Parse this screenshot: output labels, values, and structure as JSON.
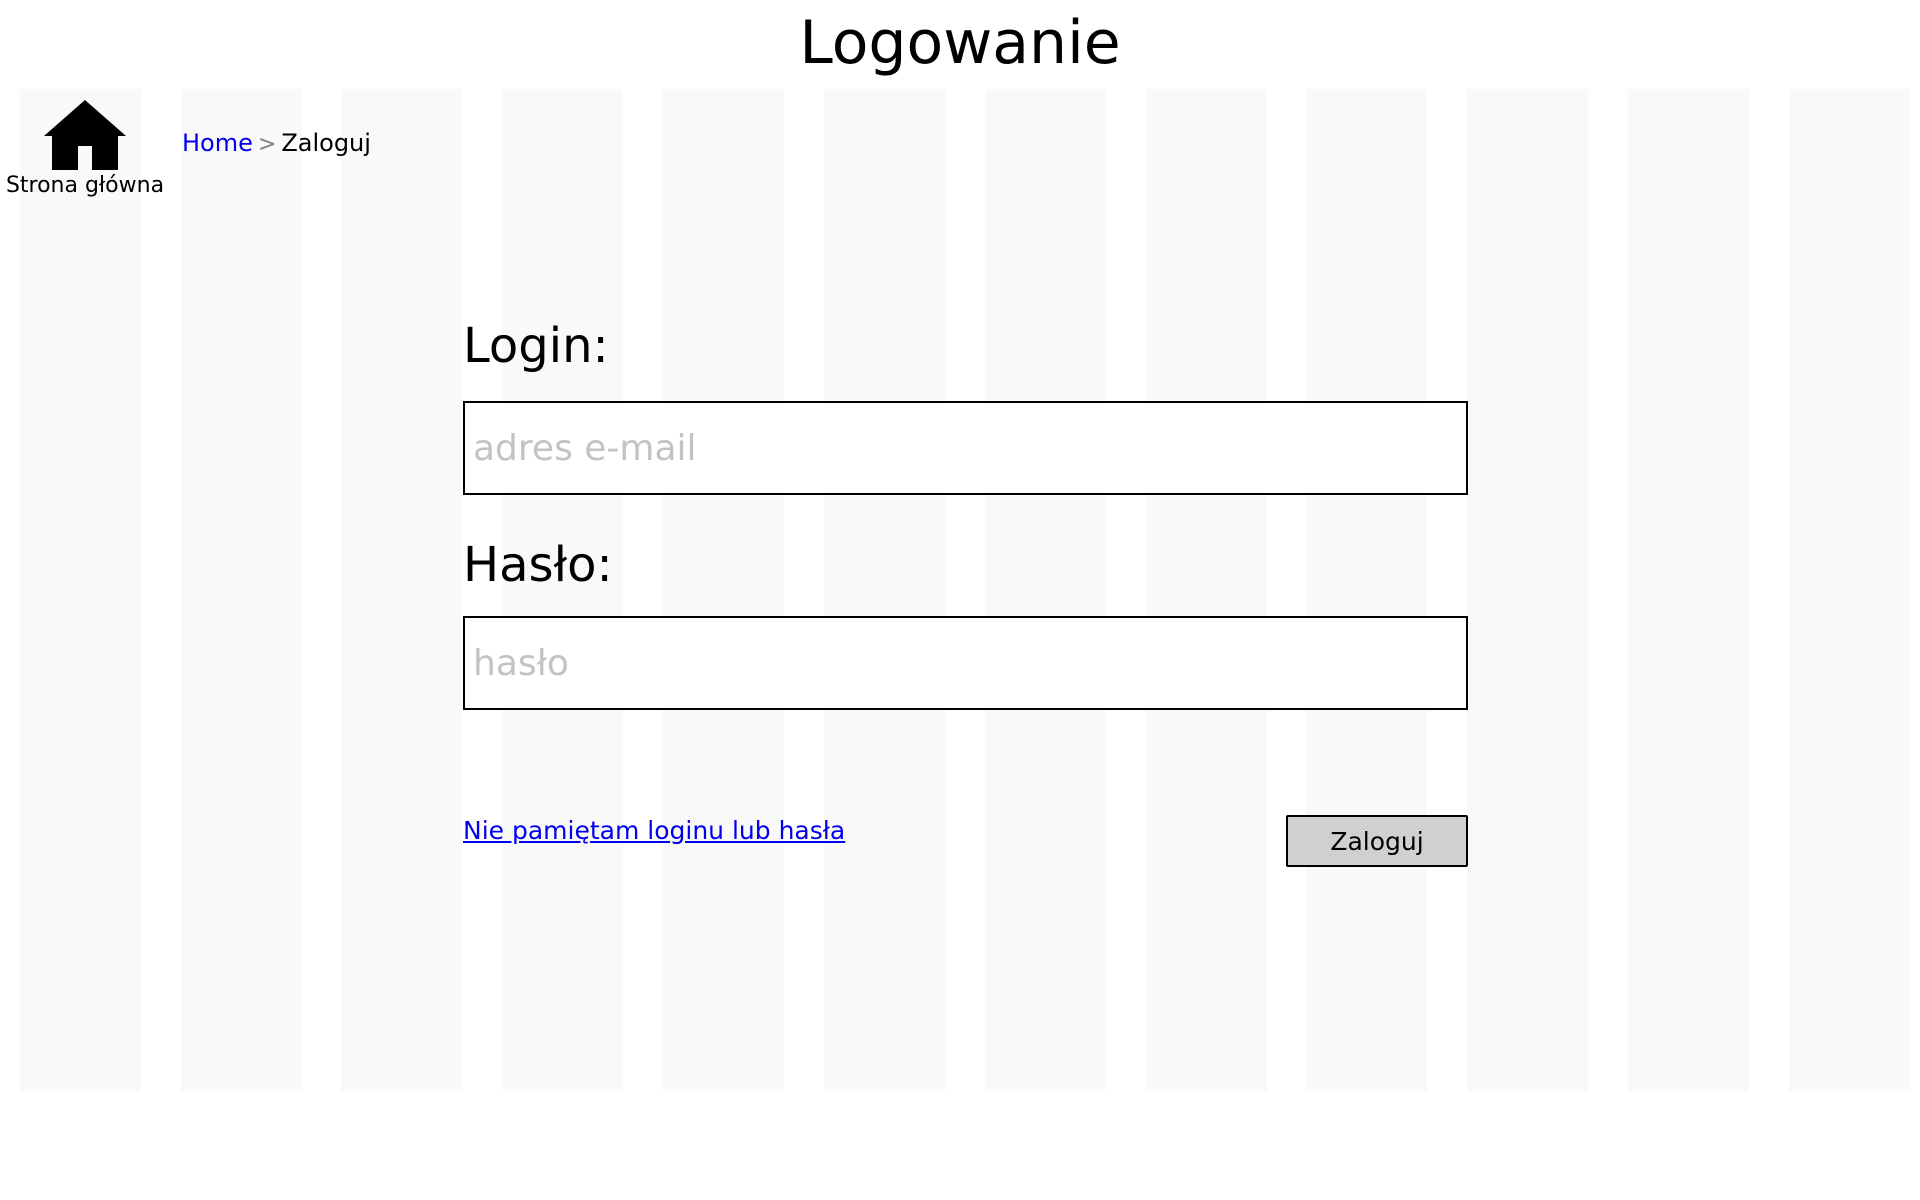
{
  "page": {
    "title": "Logowanie"
  },
  "nav": {
    "home_icon": "home-icon",
    "home_label": "Strona główna"
  },
  "breadcrumb": {
    "items": [
      "Home",
      "Zaloguj"
    ],
    "separator": ">"
  },
  "form": {
    "login_label": "Login:",
    "login_placeholder": "adres e-mail",
    "login_value": "",
    "password_label": "Hasło:",
    "password_placeholder": "hasło",
    "password_value": "",
    "forgot_link": "Nie pamiętam loginu lub hasła",
    "submit_label": "Zaloguj"
  },
  "colors": {
    "link": "#0000ee",
    "button_bg": "#d0d0d0",
    "placeholder": "#c3c3c3",
    "grid_column": "#f9f9f9"
  }
}
